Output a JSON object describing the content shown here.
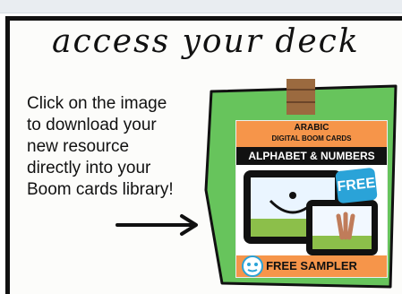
{
  "heading": "access your deck",
  "instructions": "Click on the image\nto download your\nnew resource\ndirectly into your\nBoom cards library!",
  "product": {
    "title": "ARABIC",
    "subtitle": "DIGITAL BOOM CARDS",
    "name": "ALPHABET & NUMBERS",
    "badge": "FREE",
    "footer": "FREE SAMPLER"
  },
  "colors": {
    "note": "#67c45c",
    "orange": "#f6954a",
    "badge": "#2aa3d8",
    "tape": "#9b6a3f"
  },
  "icons": [
    "arrow-right-icon",
    "tape-icon",
    "tablet-icon",
    "logo-icon"
  ]
}
